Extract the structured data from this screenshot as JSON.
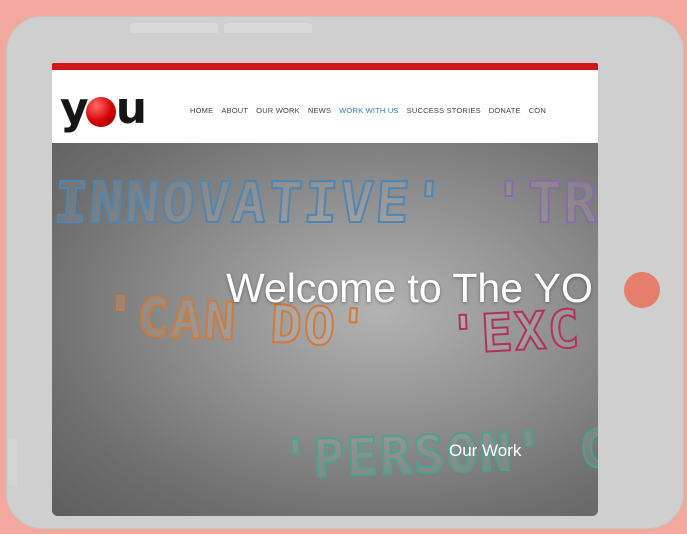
{
  "site": {
    "logo_text_left": "y",
    "logo_text_right": "u",
    "nav": [
      "HOME",
      "ABOUT",
      "OUR WORK",
      "NEWS",
      "WORK WITH US",
      "SUCCESS STORIES",
      "DONATE",
      "CON"
    ],
    "active_nav": "WORK WITH US",
    "brand_red": "#d01818"
  },
  "hero": {
    "doodles": [
      "INNOVATIVE'",
      "'TR",
      "'CAN DO'",
      "'EXC",
      "'PERSON' C"
    ],
    "welcome": "Welcome to The YO",
    "cta": "Our Work"
  },
  "device": {
    "frame_color": "#cfcfcf",
    "home_button_color": "#e57f6c",
    "background": "#f2a89c"
  }
}
